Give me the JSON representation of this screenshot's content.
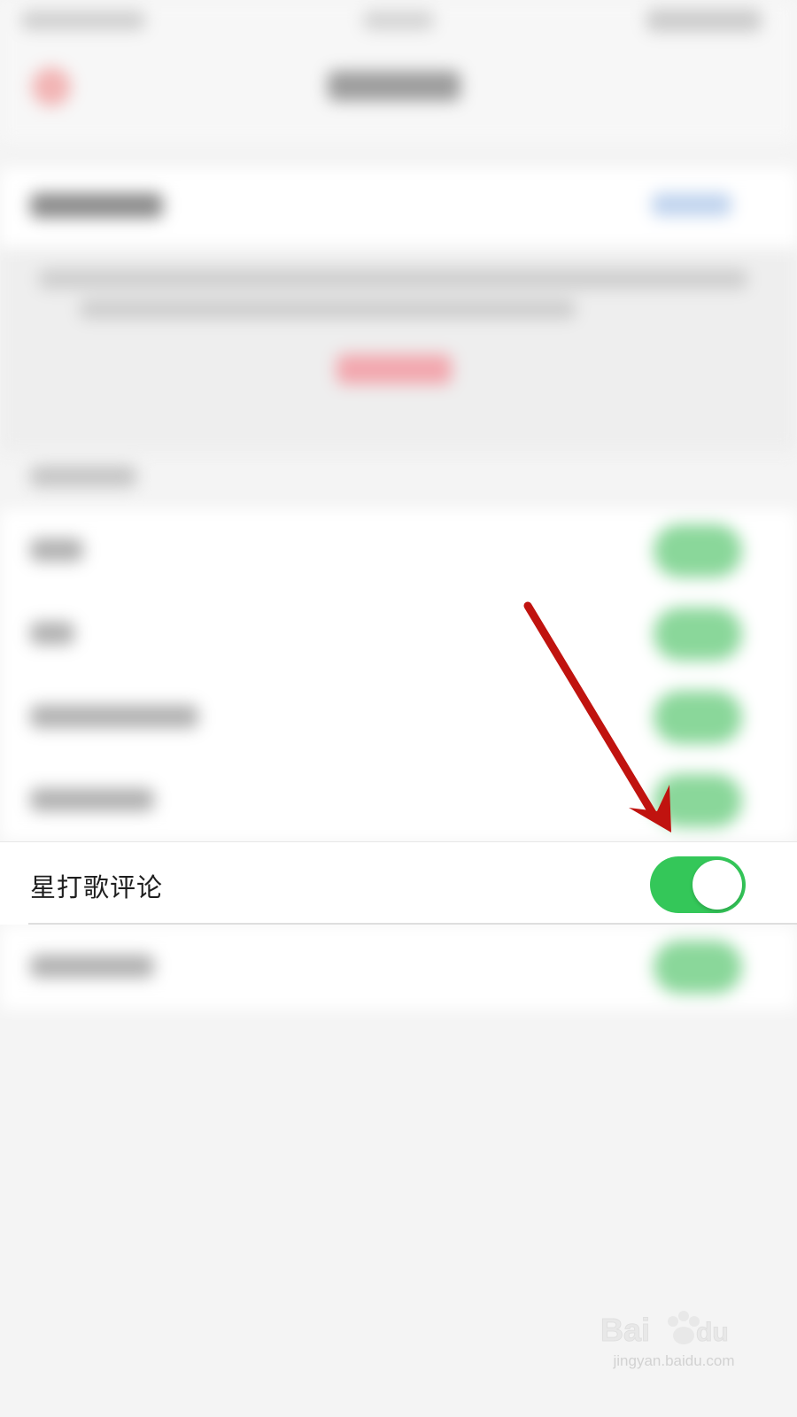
{
  "setting_row": {
    "label": "星打歌评论",
    "toggle_on": true
  },
  "colors": {
    "toggle_on": "#34c759",
    "arrow": "#c0130f"
  },
  "watermark": {
    "text": "jingyan.baidu.com"
  }
}
